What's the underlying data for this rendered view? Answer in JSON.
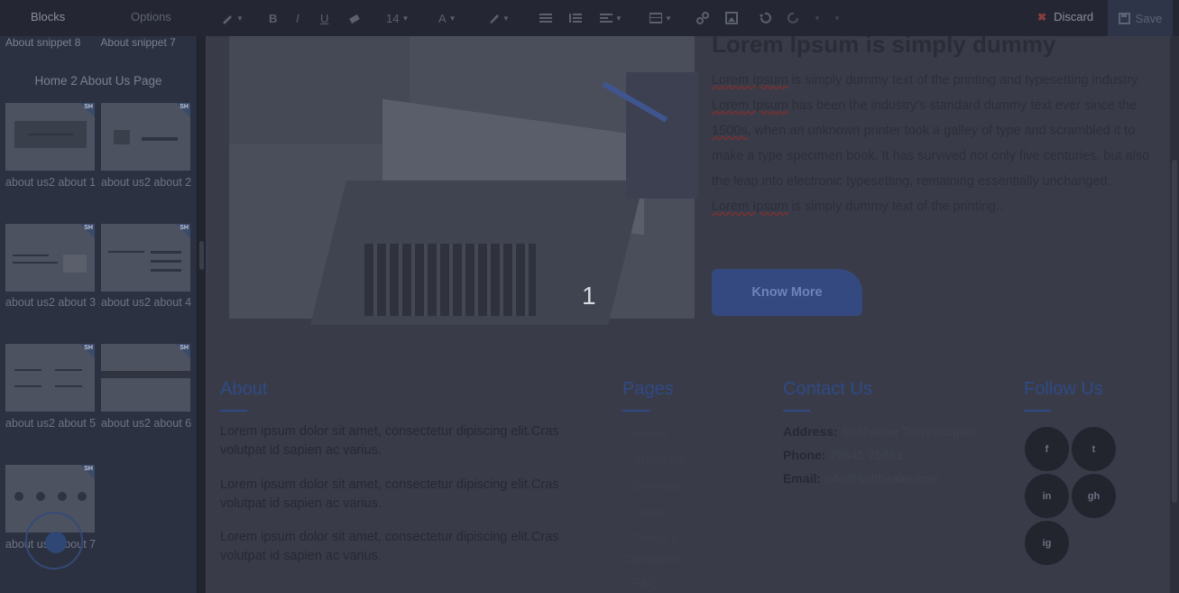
{
  "toolbar": {
    "blocks_label": "Blocks",
    "options_label": "Options",
    "font_size": "14",
    "discard_label": "Discard",
    "save_label": "Save"
  },
  "sidebar": {
    "top_labels": [
      "About snippet 8",
      "About snippet 7"
    ],
    "category_title": "Home 2 About Us Page",
    "snippets": [
      {
        "label": "about us2 about 1"
      },
      {
        "label": "about us2 about 2"
      },
      {
        "label": "about us2 about 3"
      },
      {
        "label": "about us2 about 4"
      },
      {
        "label": "about us2 about 5"
      },
      {
        "label": "about us2 about 6"
      },
      {
        "label": "about us2 about 7"
      }
    ],
    "badge": "SH"
  },
  "hero": {
    "title": "Lorem Ipsum is simply dummy",
    "paragraph_parts": [
      {
        "t": "Lorem Ipsum",
        "u": true
      },
      {
        "t": " is simply dummy text of the printing and typesetting industry. ",
        "u": false
      },
      {
        "t": "Lorem Ipsum",
        "u": true
      },
      {
        "t": " has been the industry's standard dummy text ever since the ",
        "u": false
      },
      {
        "t": "1500s",
        "u": true
      },
      {
        "t": ", when an unknown printer took a galley of type and scrambled it to make a type specimen book. It has survived not only five centuries, but also the leap into electronic typesetting, remaining essentially unchanged. ",
        "u": false
      },
      {
        "t": "Lorem Ipsum",
        "u": true
      },
      {
        "t": " is simply dummy text of the printing..",
        "u": false
      }
    ],
    "button_label": "Know More",
    "overlay_number": "1"
  },
  "footer": {
    "about": {
      "heading": "About",
      "paragraphs": [
        "Lorem ipsum dolor sit amet, consectetur dipiscing elit.Cras volutpat id sapien ac varius.",
        "Lorem ipsum dolor sit amet, consectetur dipiscing elit.Cras volutpat id sapien ac varius.",
        "Lorem ipsum dolor sit amet, consectetur dipiscing elit.Cras volutpat id sapien ac varius."
      ]
    },
    "pages": {
      "heading": "Pages",
      "links": [
        "Home",
        "About Us",
        "Services",
        "Team",
        "Terms & Conditions",
        "FAQ"
      ]
    },
    "contact": {
      "heading": "Contact Us",
      "address_label": "Address:",
      "address": "Softhealer Technologies",
      "phone_label": "Phone:",
      "phone": "79845 75681",
      "email_label": "Email:",
      "email": "info@softhealer.com"
    },
    "follow": {
      "heading": "Follow Us",
      "icons": [
        "facebook-icon",
        "twitter-icon",
        "linkedin-icon",
        "github-icon",
        "instagram-icon"
      ],
      "glyphs": [
        "f",
        "t",
        "in",
        "gh",
        "ig"
      ]
    }
  },
  "colors": {
    "accent": "#2f4a87",
    "toolbar_bg": "#242733",
    "sidebar_bg": "#2b3140",
    "canvas_bg": "#393c48"
  }
}
